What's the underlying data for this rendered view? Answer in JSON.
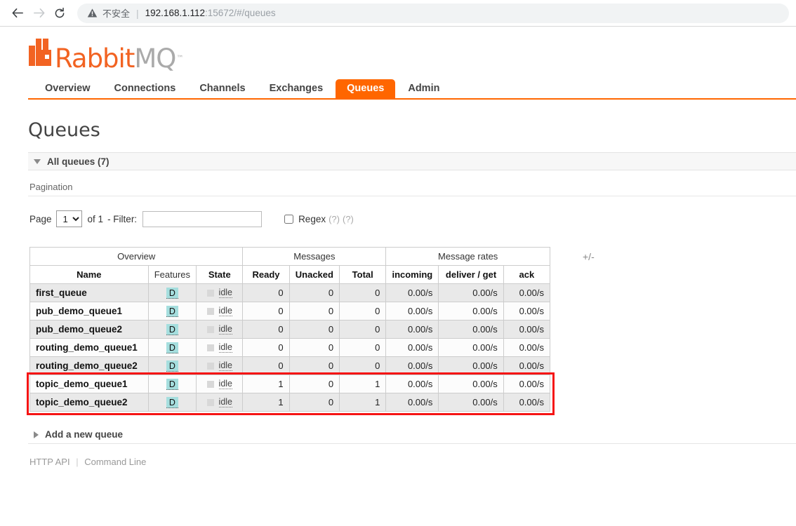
{
  "browser": {
    "back_icon": "back-arrow-icon",
    "forward_icon": "forward-arrow-icon",
    "reload_icon": "reload-icon",
    "security_icon": "not-secure-warning-icon",
    "security_text": "不安全",
    "url_host": "192.168.1.112",
    "url_rest": ":15672/#/queues"
  },
  "logo": {
    "text_primary": "Rabbit",
    "text_secondary": "MQ",
    "trademark": "™",
    "color_primary": "#f26322",
    "color_secondary": "#aaaaaa"
  },
  "nav": {
    "accent_color": "#ff6600",
    "tabs": [
      {
        "label": "Overview",
        "active": false
      },
      {
        "label": "Connections",
        "active": false
      },
      {
        "label": "Channels",
        "active": false
      },
      {
        "label": "Exchanges",
        "active": false
      },
      {
        "label": "Queues",
        "active": true
      },
      {
        "label": "Admin",
        "active": false
      }
    ]
  },
  "page": {
    "title": "Queues",
    "all_queues_label": "All queues (7)",
    "pagination_heading": "Pagination",
    "add_queue_label": "Add a new queue"
  },
  "pagination": {
    "page_label": "Page",
    "page_value": "1",
    "page_options": [
      "1"
    ],
    "of_label": "of 1",
    "filter_label": "- Filter:",
    "filter_value": "",
    "regex_label": "Regex",
    "regex_checked": false,
    "help_1": "(?)",
    "help_2": "(?)"
  },
  "table": {
    "group_headers": [
      "Overview",
      "Messages",
      "Message rates"
    ],
    "plus_minus": "+/-",
    "columns": [
      "Name",
      "Features",
      "State",
      "Ready",
      "Unacked",
      "Total",
      "incoming",
      "deliver / get",
      "ack"
    ],
    "badge_durable": "D",
    "badge_color": "#a5dede",
    "state_text": "idle",
    "rows": [
      {
        "name": "first_queue",
        "features": "D",
        "state": "idle",
        "ready": "0",
        "unacked": "0",
        "total": "0",
        "incoming": "0.00/s",
        "deliver_get": "0.00/s",
        "ack": "0.00/s",
        "highlighted": false
      },
      {
        "name": "pub_demo_queue1",
        "features": "D",
        "state": "idle",
        "ready": "0",
        "unacked": "0",
        "total": "0",
        "incoming": "0.00/s",
        "deliver_get": "0.00/s",
        "ack": "0.00/s",
        "highlighted": false
      },
      {
        "name": "pub_demo_queue2",
        "features": "D",
        "state": "idle",
        "ready": "0",
        "unacked": "0",
        "total": "0",
        "incoming": "0.00/s",
        "deliver_get": "0.00/s",
        "ack": "0.00/s",
        "highlighted": false
      },
      {
        "name": "routing_demo_queue1",
        "features": "D",
        "state": "idle",
        "ready": "0",
        "unacked": "0",
        "total": "0",
        "incoming": "0.00/s",
        "deliver_get": "0.00/s",
        "ack": "0.00/s",
        "highlighted": false
      },
      {
        "name": "routing_demo_queue2",
        "features": "D",
        "state": "idle",
        "ready": "0",
        "unacked": "0",
        "total": "0",
        "incoming": "0.00/s",
        "deliver_get": "0.00/s",
        "ack": "0.00/s",
        "highlighted": false
      },
      {
        "name": "topic_demo_queue1",
        "features": "D",
        "state": "idle",
        "ready": "1",
        "unacked": "0",
        "total": "1",
        "incoming": "0.00/s",
        "deliver_get": "0.00/s",
        "ack": "0.00/s",
        "highlighted": true
      },
      {
        "name": "topic_demo_queue2",
        "features": "D",
        "state": "idle",
        "ready": "1",
        "unacked": "0",
        "total": "1",
        "incoming": "0.00/s",
        "deliver_get": "0.00/s",
        "ack": "0.00/s",
        "highlighted": true
      }
    ]
  },
  "annotation": {
    "color": "#f51414",
    "target": "topic_demo_queue1 and topic_demo_queue2 rows"
  },
  "footer": {
    "http_api": "HTTP API",
    "separator": "|",
    "command_line": "Command Line"
  }
}
